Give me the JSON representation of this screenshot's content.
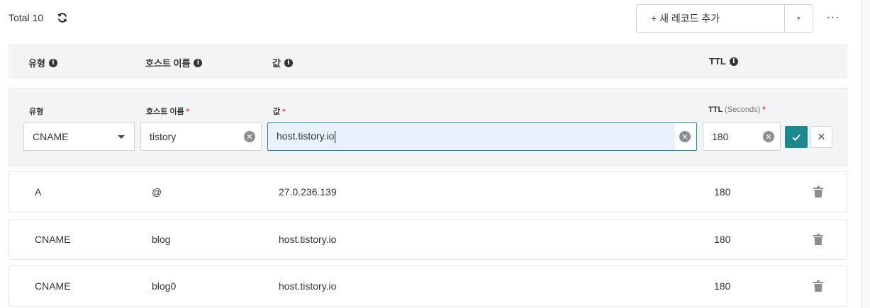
{
  "toolbar": {
    "total_label": "Total 10",
    "add_record_label": "+ 새 레코드 추가",
    "dropdown_caret": "▼",
    "more_label": "···"
  },
  "columns": {
    "type": "유형",
    "host": "호스트 이름",
    "value": "값",
    "ttl": "TTL"
  },
  "edit_form": {
    "type_label": "유형",
    "host_label": "호스트 이름",
    "value_label": "값",
    "ttl_label": "TTL",
    "ttl_unit": "(Seconds)",
    "required_mark": "*",
    "type_value": "CNAME",
    "host_value": "tistory",
    "value_value": "host.tistory.io",
    "ttl_value": "180"
  },
  "records": [
    {
      "type": "A",
      "host": "@",
      "value": "27.0.236.139",
      "ttl": "180"
    },
    {
      "type": "CNAME",
      "host": "blog",
      "value": "host.tistory.io",
      "ttl": "180"
    },
    {
      "type": "CNAME",
      "host": "blog0",
      "value": "host.tistory.io",
      "ttl": "180"
    }
  ],
  "colors": {
    "accent": "#1b8a8f",
    "required": "#e63c3c",
    "panel_bg": "#f2f4f6",
    "active_field_bg": "#e9f1fd"
  },
  "icons": [
    "refresh-icon",
    "info-icon",
    "chevron-down-icon",
    "clear-icon",
    "check-icon",
    "close-icon",
    "trash-icon"
  ]
}
